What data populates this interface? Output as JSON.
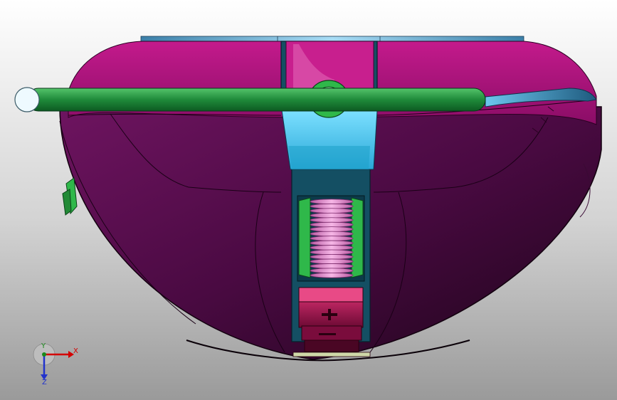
{
  "viewport": {
    "background_top": "#ffffff",
    "background_bottom": "#9a9a9a"
  },
  "model": {
    "colors": {
      "housing_top": "#b0147c",
      "housing_body": "#5a0a4e",
      "housing_edge": "#1e0018",
      "center_slot": "#1a6b82",
      "center_slot_cap": "#45c8f0",
      "handle_rod": "#1f8a3a",
      "handle_rod_end": "#eefaff",
      "spring": "#e890d2",
      "spring_guides": "#2fb84a",
      "nut_stack": "#c0165e",
      "top_plate": "#4aa6d4"
    }
  },
  "triad": {
    "x_label": "X",
    "y_label": "Y",
    "z_label": "Z",
    "x_color": "#d40000",
    "y_color": "#1a8a1a",
    "z_color": "#2233cc"
  }
}
